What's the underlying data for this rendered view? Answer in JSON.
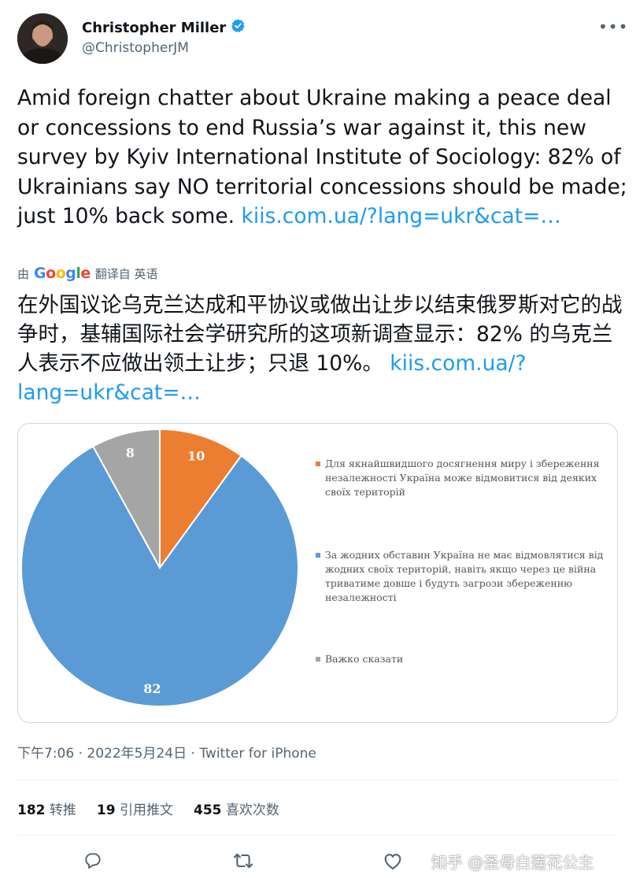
{
  "author": {
    "name": "Christopher Miller",
    "handle": "@ChristopherJM",
    "verified_icon": "verified-badge-icon",
    "badge_color": "#1d9bf0"
  },
  "more_icon": "more-icon",
  "tweet": {
    "text": "Amid foreign chatter about Ukraine making a peace deal or concessions to end Russia’s war against it, this new survey by Kyiv International Institute of Sociology: 82% of Ukrainians say NO territorial concessions should be made; just 10% back some. ",
    "link": "kiis.com.ua/?lang=ukr&cat=…"
  },
  "translation": {
    "by_prefix": "由",
    "google": "Google",
    "from_label": "翻译自 英语",
    "text": "在外国议论乌克兰达成和平协议或做出让步以结束俄罗斯对它的战争时，基辅国际社会学研究所的这项新调查显示：82% 的乌克兰人表示不应做出领土让步；只退 10%。 ",
    "link": "kiis.com.ua/?lang=ukr&cat=…"
  },
  "chart_data": {
    "type": "pie",
    "series": [
      {
        "value": 10,
        "label": "10",
        "legend": "Для якнайшвидшого досягнення миру і збереження незалежності Україна може відмовитися від деяких своїх територій",
        "color": "#ed7d31"
      },
      {
        "value": 82,
        "label": "82",
        "legend": "За жодних обставин Україна не має відмовлятися від жодних своїх територій, навіть якщо через це війна триватиме довше і будуть загрози збереженню незалежності",
        "color": "#5b9bd5"
      },
      {
        "value": 8,
        "label": "8",
        "legend": "Важко сказати",
        "color": "#a5a5a5"
      }
    ]
  },
  "meta": {
    "time": "下午7:06",
    "sep1": " · ",
    "date": "2022年5月24日",
    "sep2": " · ",
    "source": "Twitter for iPhone"
  },
  "stats": {
    "retweets_count": "182",
    "retweets_label": "转推",
    "quotes_count": "19",
    "quotes_label": "引用推文",
    "likes_count": "455",
    "likes_label": "喜欢次数"
  },
  "actions": [
    "reply-icon",
    "retweet-icon",
    "like-icon"
  ],
  "watermark": "知乎 @圣母白莲花公主"
}
